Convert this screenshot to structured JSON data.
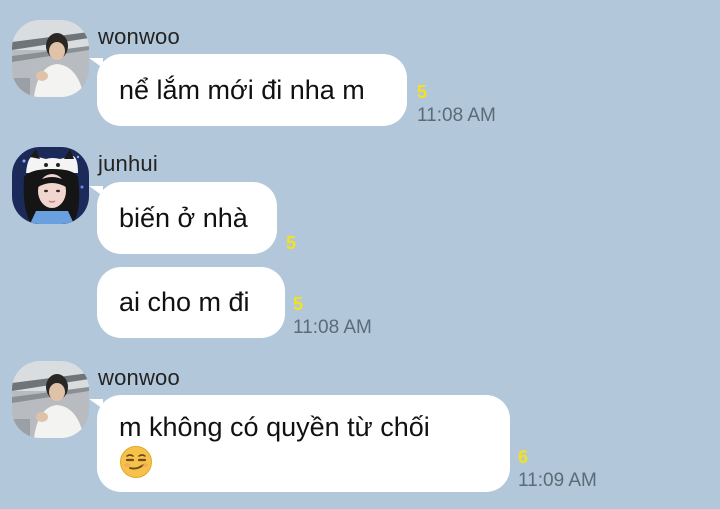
{
  "colors": {
    "background": "#b2c7d9",
    "bubble": "#ffffff",
    "unread": "#f4e11f",
    "time": "#5a6b79"
  },
  "messages": [
    {
      "sender": "wonwoo",
      "text": "nể lắm mới đi nha m",
      "unread": "5",
      "time": "11:08 AM"
    },
    {
      "sender": "junhui",
      "text": "biến ở nhà",
      "unread": "5",
      "time": ""
    },
    {
      "sender": "",
      "text": "ai cho m đi",
      "unread": "5",
      "time": "11:08 AM"
    },
    {
      "sender": "wonwoo",
      "text": "m không có quyền từ chối",
      "emoji": "smirking-face",
      "unread": "6",
      "time": "11:09 AM"
    }
  ]
}
